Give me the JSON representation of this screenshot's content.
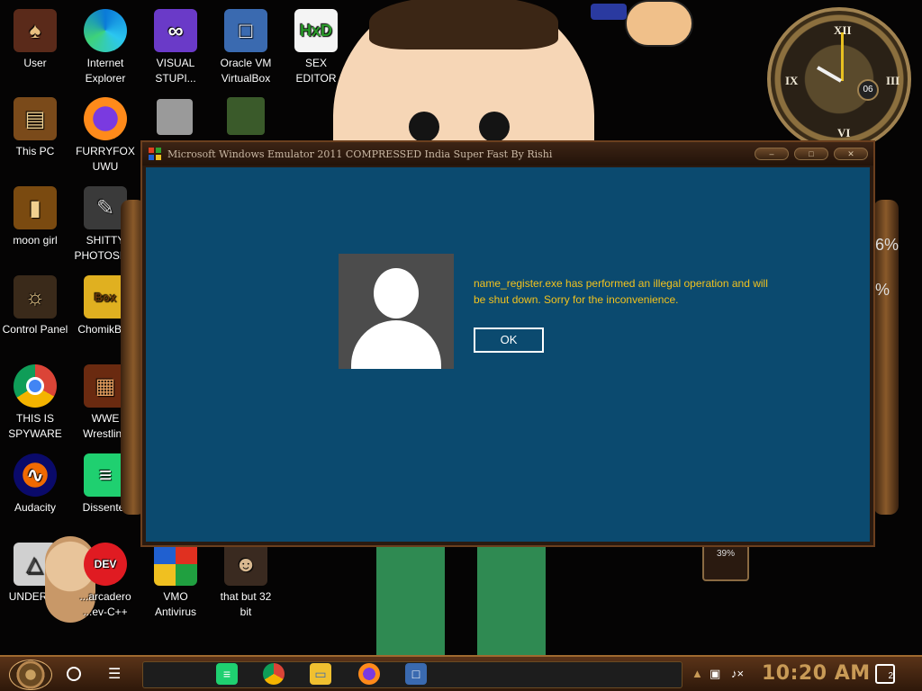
{
  "desktop": {
    "icons": [
      {
        "id": "user",
        "label": "User"
      },
      {
        "id": "internet-explorer",
        "label": "Internet\nExplorer"
      },
      {
        "id": "visual-studio",
        "label": "VISUAL\nSTUPI..."
      },
      {
        "id": "virtualbox",
        "label": "Oracle VM\nVirtualBox"
      },
      {
        "id": "sex-editor",
        "label": "SEX\nEDITOR"
      },
      {
        "id": "this-pc",
        "label": "This PC"
      },
      {
        "id": "furryfox",
        "label": "FURRYFOX\nUWU"
      },
      {
        "id": "moon-girl",
        "label": "moon girl"
      },
      {
        "id": "shitty-photoshop",
        "label": "SHITTY\nPHOTOSH..."
      },
      {
        "id": "control-panel",
        "label": "Control Panel"
      },
      {
        "id": "chomikbox",
        "label": "ChomikBox"
      },
      {
        "id": "chrome",
        "label": "THIS IS\nSPYWARE"
      },
      {
        "id": "wwe-wrestling",
        "label": "WWE\nWrestling"
      },
      {
        "id": "audacity",
        "label": "Audacity"
      },
      {
        "id": "dissenter",
        "label": "Dissenter"
      },
      {
        "id": "undertale",
        "label": "UNDERT..."
      },
      {
        "id": "dev-cpp",
        "label": "...arcadero\n...ev-C++"
      },
      {
        "id": "vmo-antivirus",
        "label": "VMO\nAntivirus"
      },
      {
        "id": "that-but-32",
        "label": "that but 32\nbit"
      }
    ]
  },
  "clock_widget": {
    "numerals": [
      "XII",
      "III",
      "VI",
      "IX"
    ],
    "date": "06"
  },
  "side_gadget": {
    "pct_a": "6%",
    "pct_b": "%",
    "battery": "39%"
  },
  "window": {
    "title": "Microsoft Windows Emulator 2011 COMPRESSED India Super Fast By Rishi",
    "controls": [
      "min",
      "max",
      "close"
    ],
    "message": "name_register.exe has performed an illegal operation and will be shut down. Sorry for the inconvenience.",
    "ok_label": "OK"
  },
  "taskbar": {
    "pinned": [
      "Dissenter",
      "Chrome",
      "File Explorer",
      "Firefox",
      "VirtualBox"
    ],
    "clock": "10:20 AM",
    "notifications": "2"
  },
  "colors": {
    "dialog_bg": "#0b4a6f",
    "message_text": "#f2c21e",
    "clock_text": "#c89a56"
  }
}
